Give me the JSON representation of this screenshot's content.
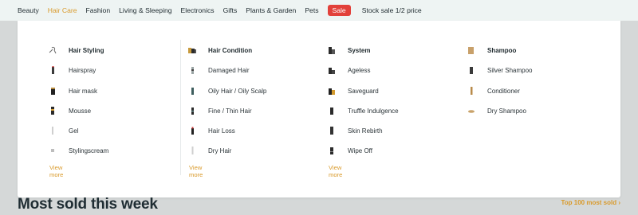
{
  "nav": {
    "items": [
      "Beauty",
      "Hair Care",
      "Fashion",
      "Living & Sleeping",
      "Electronics",
      "Gifts",
      "Plants & Garden",
      "Pets"
    ],
    "active": "Hair Care",
    "sale_label": "Sale",
    "promo_label": "Stock sale 1/2 price"
  },
  "menu": {
    "columns": [
      {
        "heading": "Hair Styling",
        "heading_icon": "hairdryer-icon",
        "items": [
          {
            "label": "Hairspray",
            "icon": "spray-can-icon"
          },
          {
            "label": "Hair mask",
            "icon": "jar-icon"
          },
          {
            "label": "Mousse",
            "icon": "mousse-can-icon"
          },
          {
            "label": "Gel",
            "icon": "tube-icon"
          },
          {
            "label": "Stylingscream",
            "icon": "cream-tube-icon"
          }
        ],
        "view_more": "View more"
      },
      {
        "heading": "Hair Condition",
        "heading_icon": "product-set-icon",
        "items": [
          {
            "label": "Damaged Hair",
            "icon": "bottle-icon"
          },
          {
            "label": "Oily Hair / Oily Scalp",
            "icon": "bottle-icon"
          },
          {
            "label": "Fine / Thin Hair",
            "icon": "bottle-icon"
          },
          {
            "label": "Hair Loss",
            "icon": "bottle-icon"
          },
          {
            "label": "Dry Hair",
            "icon": "bottle-icon"
          }
        ],
        "view_more": "View more"
      },
      {
        "heading": "System",
        "heading_icon": "product-set-icon",
        "items": [
          {
            "label": "Ageless",
            "icon": "product-pair-icon"
          },
          {
            "label": "Saveguard",
            "icon": "product-pair-icon"
          },
          {
            "label": "Truffle Indulgence",
            "icon": "bottle-icon"
          },
          {
            "label": "Skin Rebirth",
            "icon": "bottle-icon"
          },
          {
            "label": "Wipe Off",
            "icon": "bottle-icon"
          }
        ],
        "view_more": "View more"
      },
      {
        "heading": "Shampoo",
        "heading_icon": "shampoo-box-icon",
        "items": [
          {
            "label": "Silver Shampoo",
            "icon": "bottle-icon"
          },
          {
            "label": "Conditioner",
            "icon": "bottle-icon"
          },
          {
            "label": "Dry Shampoo",
            "icon": "powder-icon"
          }
        ]
      }
    ]
  },
  "section": {
    "title": "Most sold this week",
    "link": "Top 100 most sold ›"
  },
  "colors": {
    "accent": "#d99a2b",
    "sale": "#e2413a",
    "nav_bg": "#eef4f3",
    "page_bg": "#d5d8d8"
  }
}
